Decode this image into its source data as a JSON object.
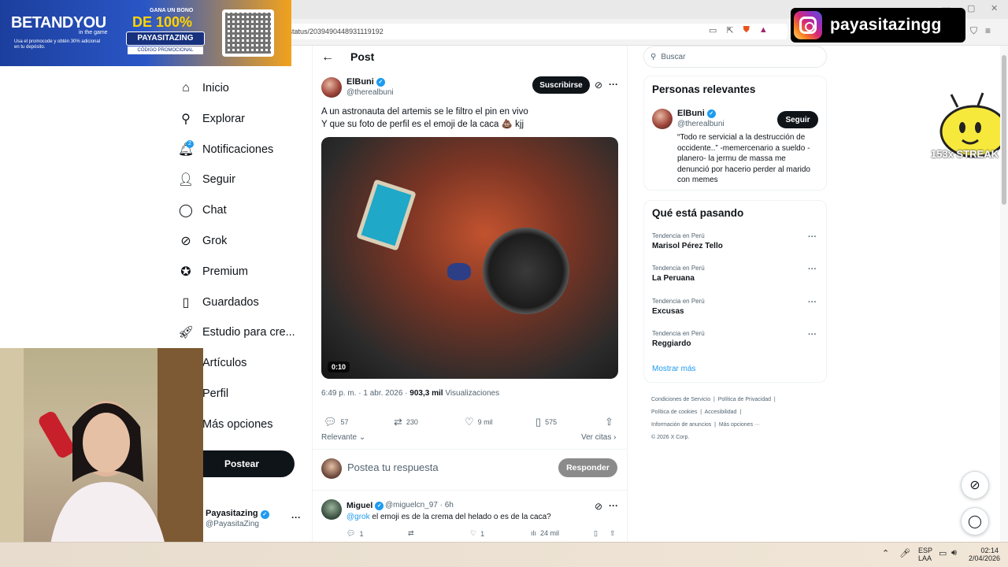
{
  "browser": {
    "url": "/status/2039490448931119192",
    "window_controls": [
      "—",
      "▢",
      "✕"
    ]
  },
  "ad": {
    "brand": "BETANDYOU",
    "brand_sub": "in the game",
    "small_text": "Usa el promocode y obtén 30% adicional en tu depósito.",
    "kicker": "GANA UN BONO",
    "headline": "DE 100%",
    "code": "PAYASITAZING",
    "code_sub": "CÓDIGO PROMOCIONAL"
  },
  "overlay": {
    "instagram_handle": "payasitazingg",
    "streak": "153x STREAK"
  },
  "nav": {
    "items": [
      {
        "label": "Inicio",
        "icon": "home-icon"
      },
      {
        "label": "Explorar",
        "icon": "search-icon"
      },
      {
        "label": "Notificaciones",
        "icon": "bell-icon"
      },
      {
        "label": "Seguir",
        "icon": "add-user-icon"
      },
      {
        "label": "Chat",
        "icon": "chat-icon"
      },
      {
        "label": "Grok",
        "icon": "grok-icon"
      },
      {
        "label": "Premium",
        "icon": "premium-icon"
      },
      {
        "label": "Guardados",
        "icon": "bookmark-icon"
      },
      {
        "label": "Estudio para cre...",
        "icon": "rocket-icon"
      },
      {
        "label": "Artículos",
        "icon": "article-icon"
      },
      {
        "label": "Perfil",
        "icon": "profile-icon"
      },
      {
        "label": "Más opciones",
        "icon": "more-icon"
      }
    ],
    "notification_count": "2",
    "post_button": "Postear",
    "profile": {
      "name": "Payasitazing",
      "handle": "@PayasitaZing"
    }
  },
  "post": {
    "header_title": "Post",
    "author_name": "ElBuni",
    "author_handle": "@therealbuni",
    "subscribe_label": "Suscribirse",
    "text_line1": "A un astronauta del artemis se le filtro el pin en vivo",
    "text_line2": "Y que su foto de perfil es el emoji de la caca 💩 kjj",
    "video_duration": "0:10",
    "time": "6:49 p. m. · 1 abr. 2026 · ",
    "views_count": "903,3 mil",
    "views_label": " Visualizaciones",
    "replies": "57",
    "reposts": "230",
    "likes": "9 mil",
    "bookmarks": "575",
    "sort_label": "Relevante",
    "quotes_label": "Ver citas",
    "reply_placeholder": "Postea tu respuesta",
    "reply_button": "Responder"
  },
  "reply": {
    "name": "Miguel",
    "meta": "@miguelcn_97 · 6h",
    "mention": "@grok",
    "text": " el emoji es de la crema del helado o es de la caca?",
    "replies": "1",
    "likes": "1",
    "views": "24 mil"
  },
  "sidebar": {
    "search_placeholder": "Buscar",
    "relevant_title": "Personas relevantes",
    "person": {
      "name": "ElBuni",
      "handle": "@therealbuni",
      "follow_label": "Seguir",
      "bio": "“Todo re servicial a la destrucción de occidente..” -memercenario a sueldo -planero- la jermu de massa me denunció por hacerio perder al marido con memes"
    },
    "trends_title": "Qué está pasando",
    "trends": [
      {
        "category": "Tendencia en Perú",
        "name": "Marisol Pérez Tello"
      },
      {
        "category": "Tendencia en Perú",
        "name": "La Peruana"
      },
      {
        "category": "Tendencia en Perú",
        "name": "Excusas"
      },
      {
        "category": "Tendencia en Perú",
        "name": "Reggiardo"
      }
    ],
    "show_more": "Mostrar más",
    "footer": {
      "line1a": "Condiciones de Servicio",
      "line1b": "Política de Privacidad",
      "line2a": "Política de cookies",
      "line2b": "Accesibilidad",
      "line3a": "Información de anuncios",
      "line3b": "Más opciones ···",
      "copyright": "© 2026 X Corp."
    }
  },
  "taskbar": {
    "lang1": "ESP",
    "lang2": "LAA",
    "time": "02:14",
    "date": "2/04/2026"
  },
  "colors": {
    "accent": "#1d9bf0",
    "text": "#0f1419",
    "muted": "#536471"
  }
}
